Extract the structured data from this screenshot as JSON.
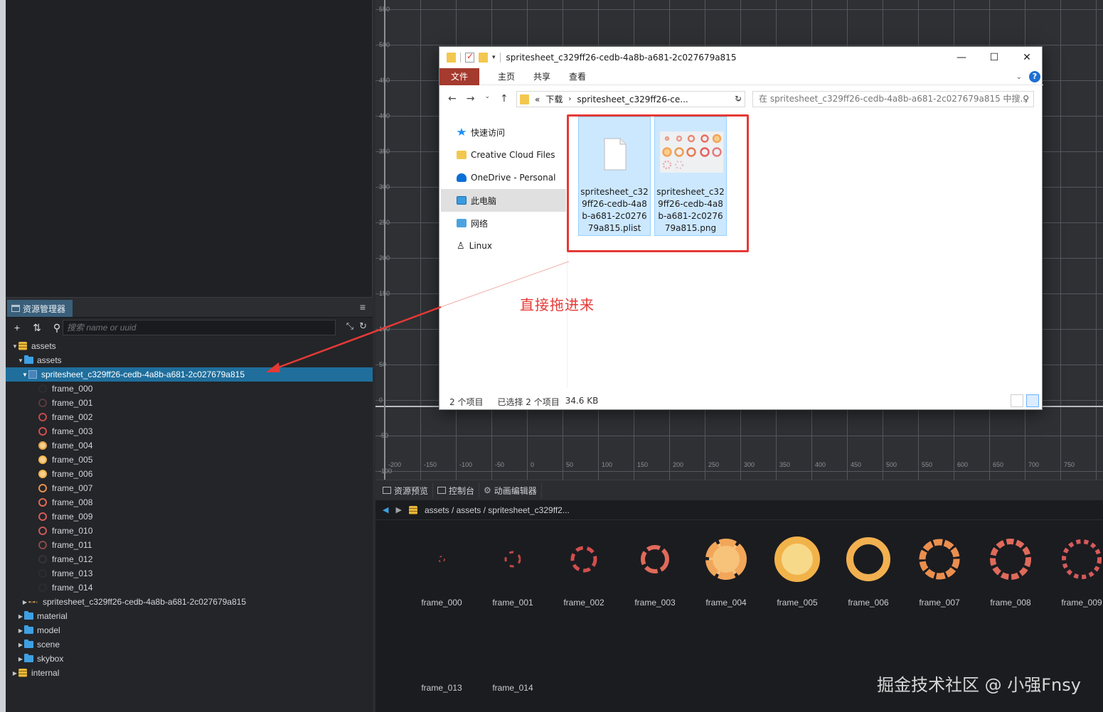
{
  "scene": {
    "y_labels": [
      "550",
      "500",
      "450",
      "400",
      "350",
      "300",
      "250",
      "200",
      "150",
      "100",
      "50",
      "0",
      "-50",
      "-100"
    ],
    "x_labels": [
      "-200",
      "-150",
      "-100",
      "-50",
      "0",
      "50",
      "100",
      "150",
      "200",
      "250",
      "300",
      "350",
      "400",
      "450",
      "500",
      "550",
      "600",
      "650",
      "700",
      "750"
    ]
  },
  "assets_panel": {
    "tab_label": "资源管理器",
    "search_placeholder": "搜索 name or uuid",
    "tree": {
      "root": "assets",
      "sub_assets": "assets",
      "spritesheet": "spritesheet_c329ff26-cedb-4a8b-a681-2c027679a815",
      "frames": [
        "frame_000",
        "frame_001",
        "frame_002",
        "frame_003",
        "frame_004",
        "frame_005",
        "frame_006",
        "frame_007",
        "frame_008",
        "frame_009",
        "frame_010",
        "frame_011",
        "frame_012",
        "frame_013",
        "frame_014"
      ],
      "spritesheet_png": "spritesheet_c329ff26-cedb-4a8b-a681-2c027679a815",
      "folders": [
        "material",
        "model",
        "scene",
        "skybox"
      ],
      "internal": "internal"
    }
  },
  "preview": {
    "tabs": [
      "资源预览",
      "控制台",
      "动画编辑器"
    ],
    "path": "assets / assets / spritesheet_c329ff2...",
    "row1": [
      "frame_000",
      "frame_001",
      "frame_002",
      "frame_003",
      "frame_004",
      "frame_005",
      "frame_006",
      "frame_007",
      "frame_008",
      "frame_009"
    ],
    "row2": [
      "frame_013",
      "frame_014"
    ]
  },
  "explorer": {
    "title": "spritesheet_c329ff26-cedb-4a8b-a681-2c027679a815",
    "ribbon": {
      "file": "文件",
      "home": "主页",
      "share": "共享",
      "view": "查看"
    },
    "address": {
      "prefix": "«",
      "crumb1": "下载",
      "crumb2": "spritesheet_c329ff26-ce..."
    },
    "search_placeholder": "在 spritesheet_c329ff26-cedb-4a8b-a681-2c027679a815 中搜...",
    "nav": [
      "快速访问",
      "Creative Cloud Files",
      "OneDrive - Personal",
      "此电脑",
      "网络",
      "Linux"
    ],
    "files": [
      {
        "name": "spritesheet_c32 9ff26-cedb-4a8 b-a681-2c0276 79a815.plist",
        "lines": [
          "spritesheet_c32",
          "9ff26-cedb-4a8",
          "b-a681-2c0276",
          "79a815.plist"
        ]
      },
      {
        "name": "spritesheet_c32 9ff26-cedb-4a8 b-a681-2c0276 79a815.png",
        "lines": [
          "spritesheet_c32",
          "9ff26-cedb-4a8",
          "b-a681-2c0276",
          "79a815.png"
        ]
      }
    ],
    "status": {
      "count": "2 个项目",
      "selected": "已选择 2 个项目",
      "size": "34.6 KB"
    }
  },
  "annotation": "直接拖进来",
  "watermark": "掘金技术社区 @ 小强Fnsy"
}
